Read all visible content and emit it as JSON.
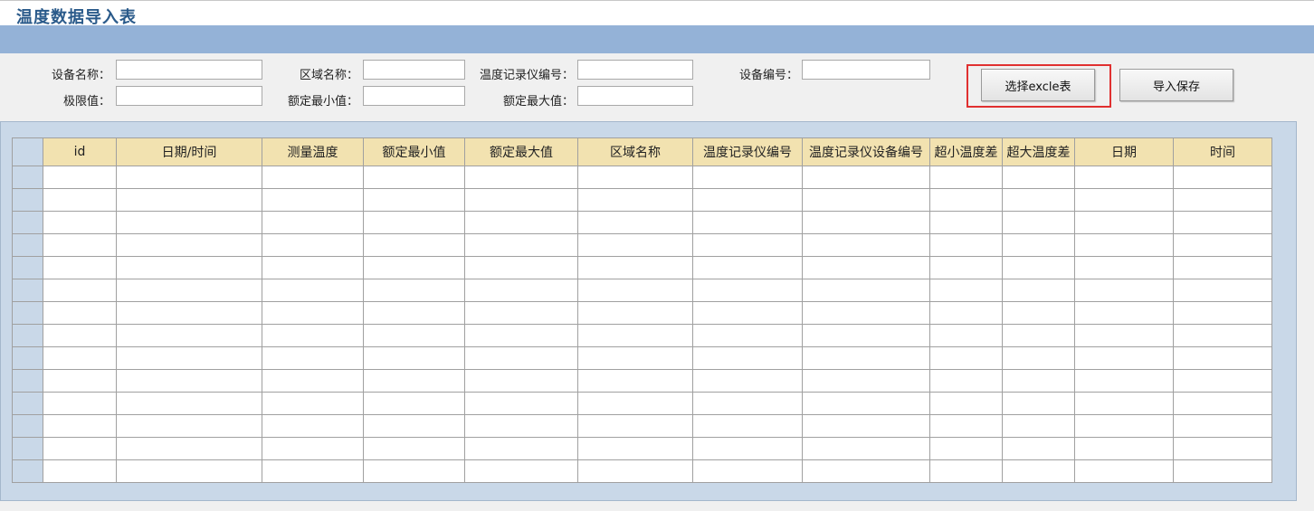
{
  "page": {
    "title": "温度数据导入表"
  },
  "form": {
    "device_name_label": "设备名称：",
    "device_name_value": "",
    "area_name_label": "区域名称：",
    "area_name_value": "",
    "recorder_no_label": "温度记录仪编号：",
    "recorder_no_value": "",
    "device_no_label": "设备编号：",
    "device_no_value": "",
    "limit_label": "极限值：",
    "limit_value": "",
    "rated_min_label": "额定最小值：",
    "rated_min_value": "",
    "rated_max_label": "额定最大值：",
    "rated_max_value": ""
  },
  "buttons": {
    "select_excel": "选择excle表",
    "import_save": "导入保存"
  },
  "colors": {
    "title": "#2a5a8a",
    "band": "#94b2d7",
    "header_bg": "#f2e2b0",
    "panel_bg": "#c9d8e8",
    "highlight": "#e03030"
  },
  "table": {
    "columns": [
      "id",
      "日期/时间",
      "测量温度",
      "额定最小值",
      "额定最大值",
      "区域名称",
      "温度记录仪编号",
      "温度记录仪设备编号",
      "超小温度差",
      "超大温度差",
      "日期",
      "时间"
    ],
    "rows": [
      [
        "",
        "",
        "",
        "",
        "",
        "",
        "",
        "",
        "",
        "",
        "",
        ""
      ],
      [
        "",
        "",
        "",
        "",
        "",
        "",
        "",
        "",
        "",
        "",
        "",
        ""
      ],
      [
        "",
        "",
        "",
        "",
        "",
        "",
        "",
        "",
        "",
        "",
        "",
        ""
      ],
      [
        "",
        "",
        "",
        "",
        "",
        "",
        "",
        "",
        "",
        "",
        "",
        ""
      ],
      [
        "",
        "",
        "",
        "",
        "",
        "",
        "",
        "",
        "",
        "",
        "",
        ""
      ],
      [
        "",
        "",
        "",
        "",
        "",
        "",
        "",
        "",
        "",
        "",
        "",
        ""
      ],
      [
        "",
        "",
        "",
        "",
        "",
        "",
        "",
        "",
        "",
        "",
        "",
        ""
      ],
      [
        "",
        "",
        "",
        "",
        "",
        "",
        "",
        "",
        "",
        "",
        "",
        ""
      ],
      [
        "",
        "",
        "",
        "",
        "",
        "",
        "",
        "",
        "",
        "",
        "",
        ""
      ],
      [
        "",
        "",
        "",
        "",
        "",
        "",
        "",
        "",
        "",
        "",
        "",
        ""
      ],
      [
        "",
        "",
        "",
        "",
        "",
        "",
        "",
        "",
        "",
        "",
        "",
        ""
      ],
      [
        "",
        "",
        "",
        "",
        "",
        "",
        "",
        "",
        "",
        "",
        "",
        ""
      ],
      [
        "",
        "",
        "",
        "",
        "",
        "",
        "",
        "",
        "",
        "",
        "",
        ""
      ],
      [
        "",
        "",
        "",
        "",
        "",
        "",
        "",
        "",
        "",
        "",
        "",
        ""
      ]
    ]
  }
}
